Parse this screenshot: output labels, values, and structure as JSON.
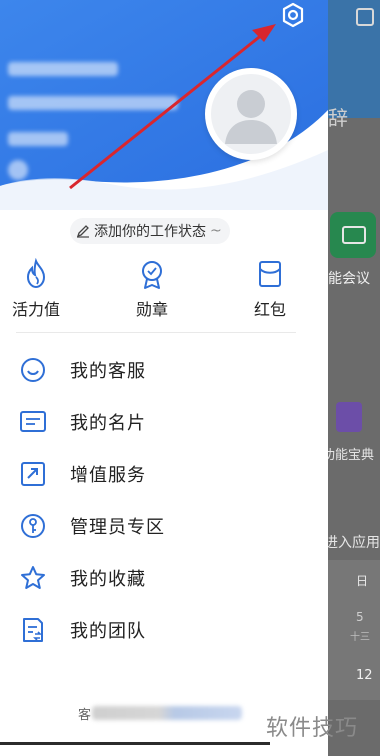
{
  "background_app": {
    "title_partial": "辞",
    "meeting_label": "智能会议",
    "book_label": "功能宝典",
    "apps_label": "进入应用",
    "calendar": {
      "day_label": "日",
      "date_1": "5",
      "lunar_1": "十三",
      "date_2": "12"
    }
  },
  "drawer": {
    "status": {
      "label": "添加你的工作状态",
      "suffix": "~"
    },
    "quick_actions": [
      {
        "label": "活力值",
        "icon": "flame-icon"
      },
      {
        "label": "勋章",
        "icon": "medal-icon"
      },
      {
        "label": "红包",
        "icon": "red-packet-icon"
      }
    ],
    "menu": [
      {
        "label": "我的客服",
        "icon": "customer-service-icon"
      },
      {
        "label": "我的名片",
        "icon": "business-card-icon"
      },
      {
        "label": "增值服务",
        "icon": "upgrade-service-icon"
      },
      {
        "label": "管理员专区",
        "icon": "admin-key-icon"
      },
      {
        "label": "我的收藏",
        "icon": "star-icon"
      },
      {
        "label": "我的团队",
        "icon": "team-icon"
      }
    ],
    "footer": {
      "prefix": "客"
    }
  },
  "watermark": "软件技巧",
  "colors": {
    "header_blue": "#2f7be8",
    "icon_blue": "#2f6fd6",
    "arrow_red": "#d9262e",
    "dim_overlay": "#6b6b6b"
  }
}
